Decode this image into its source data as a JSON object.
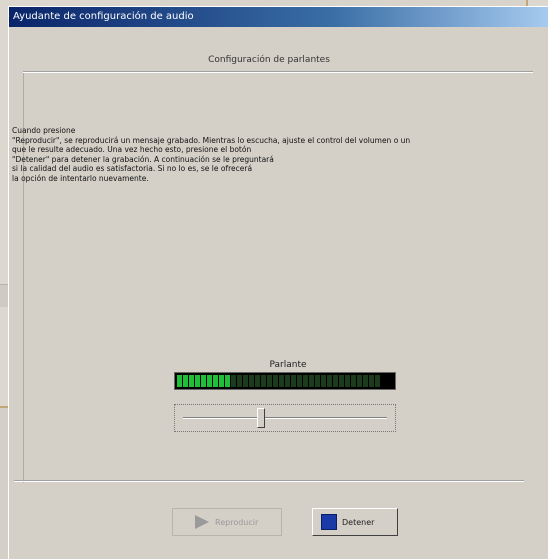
{
  "window": {
    "title": "Ayudante de configuración de audio"
  },
  "page": {
    "subtitle": "Configuración de parlantes"
  },
  "instructions": [
    "Cuando presione",
    "\"Reproducir\", se reproducirá un mensaje grabado.  Mientras lo escucha, ajuste el control del volumen o un",
    "que le resulte adecuado.  Una vez hecho esto, presione el botón",
    "\"Detener\" para detener la grabación.  A continuación se le preguntará",
    "si la calidad del audio es satisfactoria.  Si no lo es, se le ofrecerá",
    "la opción de intentarlo nuevamente."
  ],
  "volume": {
    "label": "Parlante",
    "level": 0.27,
    "slider_value": 0.38
  },
  "buttons": {
    "play_label": "Reproducir",
    "stop_label": "Detener"
  },
  "colors": {
    "meter_on": "#1fbf3a",
    "meter_off": "#1c3a1c",
    "title_bar": "#0a246a"
  }
}
